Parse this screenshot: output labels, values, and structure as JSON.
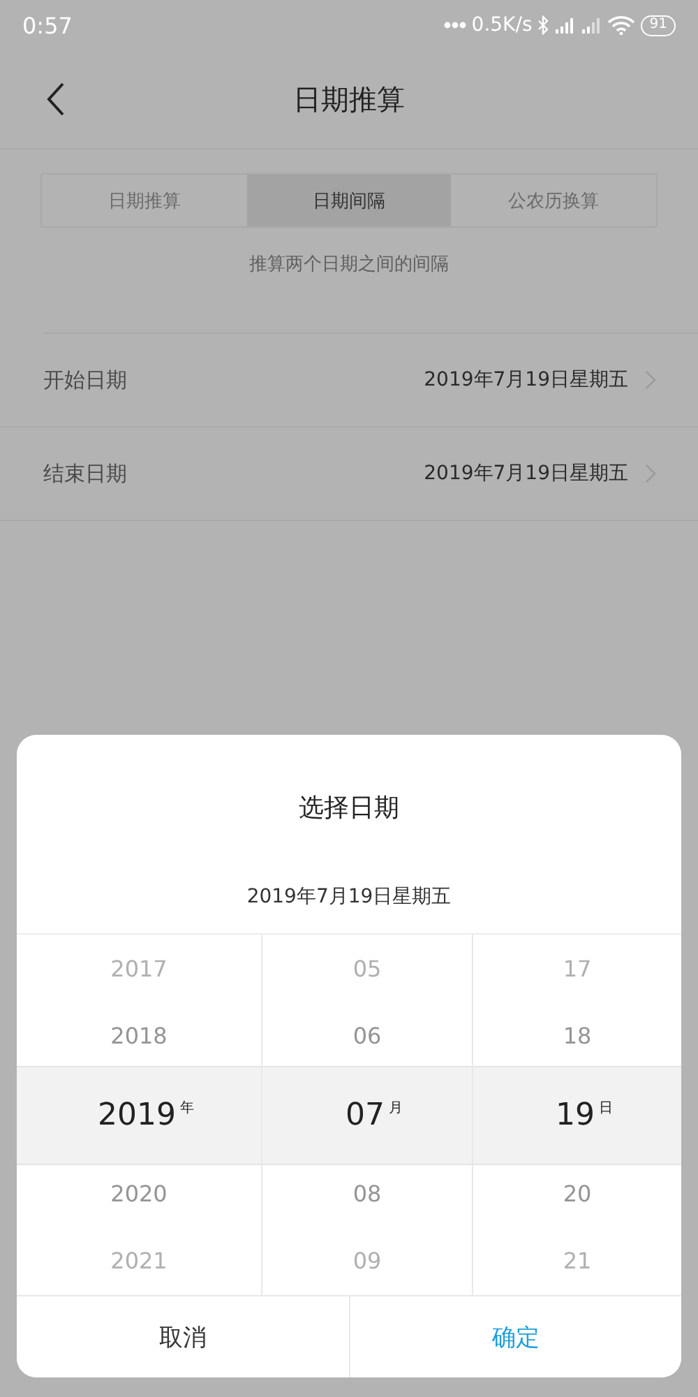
{
  "status_bar": {
    "time": "0:57",
    "speed": "0.5K/s",
    "battery": "91"
  },
  "header": {
    "title": "日期推算"
  },
  "tabs": [
    {
      "label": "日期推算",
      "selected": false
    },
    {
      "label": "日期间隔",
      "selected": true
    },
    {
      "label": "公农历换算",
      "selected": false
    }
  ],
  "description": "推算两个日期之间的间隔",
  "rows": [
    {
      "label": "开始日期",
      "value": "2019年7月19日星期五"
    },
    {
      "label": "结束日期",
      "value": "2019年7月19日星期五"
    }
  ],
  "dialog": {
    "title": "选择日期",
    "subtitle": "2019年7月19日星期五",
    "columns": [
      {
        "unit": "年",
        "items": [
          {
            "label": "2017",
            "selected": false
          },
          {
            "label": "2018",
            "selected": false
          },
          {
            "label": "2019",
            "selected": true
          },
          {
            "label": "2020",
            "selected": false
          },
          {
            "label": "2021",
            "selected": false
          }
        ]
      },
      {
        "unit": "月",
        "items": [
          {
            "label": "05",
            "selected": false
          },
          {
            "label": "06",
            "selected": false
          },
          {
            "label": "07",
            "selected": true
          },
          {
            "label": "08",
            "selected": false
          },
          {
            "label": "09",
            "selected": false
          }
        ]
      },
      {
        "unit": "日",
        "items": [
          {
            "label": "17",
            "selected": false
          },
          {
            "label": "18",
            "selected": false
          },
          {
            "label": "19",
            "selected": true
          },
          {
            "label": "20",
            "selected": false
          },
          {
            "label": "21",
            "selected": false
          }
        ]
      }
    ],
    "buttons": [
      {
        "label": "取消",
        "kind": "cancel"
      },
      {
        "label": "确定",
        "kind": "confirm"
      }
    ]
  }
}
